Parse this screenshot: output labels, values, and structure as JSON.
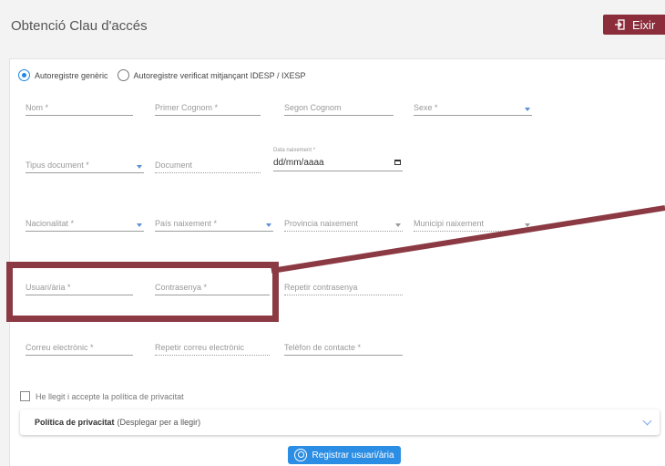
{
  "header": {
    "title": "Obtenció Clau d'accés",
    "exit_label": "Eixir"
  },
  "registration_type": {
    "options": [
      "Autoregistre genèric",
      "Autoregistre verificat mitjançant IDESP / IXESP"
    ],
    "selected": 0
  },
  "fields": {
    "nom": "Nom *",
    "primer_cognom": "Primer Cognom *",
    "segon_cognom": "Segon Cognom",
    "sexe": "Sexe *",
    "tipus_document": "Tipus document *",
    "document": "Document",
    "data_naixement_label": "Data naixement *",
    "data_naixement_value": "dd/mm/aaaa",
    "nacionalitat": "Nacionalitat *",
    "pais_naixement": "País naixement *",
    "provincia_naixement": "Provincia naixement",
    "municipi_naixement": "Municipi naixement",
    "usuari": "Usuari/ària *",
    "contrasenya": "Contrasenya *",
    "repetir_contrasenya": "Repetir contrasenya",
    "correu": "Correu electrònic *",
    "repetir_correu": "Repetir correu electrònic",
    "telefon": "Telèfon de contacte *"
  },
  "privacy": {
    "checkbox_label": "He llegit i accepte la política de privacitat",
    "accordion_title": "Política de privacitat",
    "accordion_hint": "(Desplegar per a llegir)"
  },
  "register_label": "Registrar usuari/ària",
  "colors": {
    "accent": "#2b8de3",
    "exit_button": "#8b2d3a",
    "highlight": "#8b3a44"
  }
}
